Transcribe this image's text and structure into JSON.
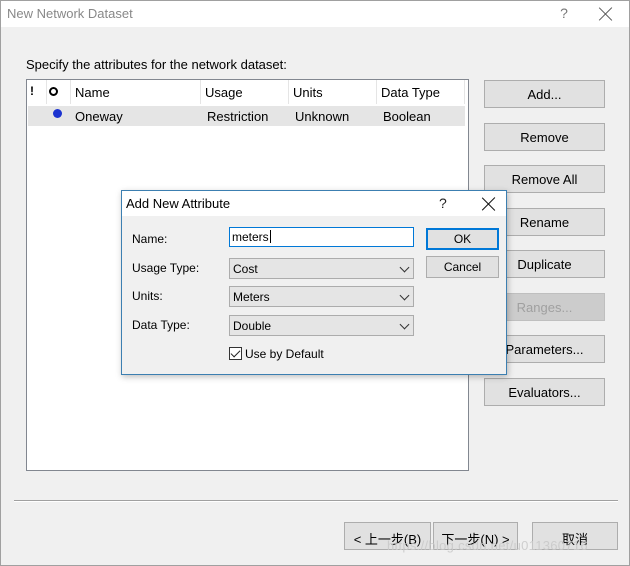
{
  "window": {
    "title": "New Network Dataset",
    "help_glyph": "?",
    "instruction": "Specify the attributes for the network dataset:"
  },
  "attributes_table": {
    "columns": [
      "Name",
      "Usage",
      "Units",
      "Data Type"
    ],
    "rows": [
      {
        "name": "Oneway",
        "usage": "Restriction",
        "units": "Unknown",
        "data_type": "Boolean"
      }
    ]
  },
  "side_buttons": {
    "add": "Add...",
    "remove": "Remove",
    "remove_all": "Remove All",
    "rename": "Rename",
    "duplicate": "Duplicate",
    "ranges": "Ranges...",
    "parameters": "Parameters...",
    "evaluators": "Evaluators..."
  },
  "footer": {
    "back": "< 上一步(B)",
    "next": "下一步(N) >",
    "cancel": "取消",
    "watermark": "https://blog.csdn.net/u011360716"
  },
  "dialog": {
    "title": "Add New Attribute",
    "help_glyph": "?",
    "name_label": "Name:",
    "name_value": "meters",
    "usage_label": "Usage Type:",
    "usage_value": "Cost",
    "units_label": "Units:",
    "units_value": "Meters",
    "datatype_label": "Data Type:",
    "datatype_value": "Double",
    "use_default_label": "Use by Default",
    "use_default_checked": true,
    "ok": "OK",
    "cancel": "Cancel"
  },
  "colors": {
    "accent": "#0078d7",
    "selected_row": "#e5e5e5",
    "status_dot": "#1c33d0"
  }
}
